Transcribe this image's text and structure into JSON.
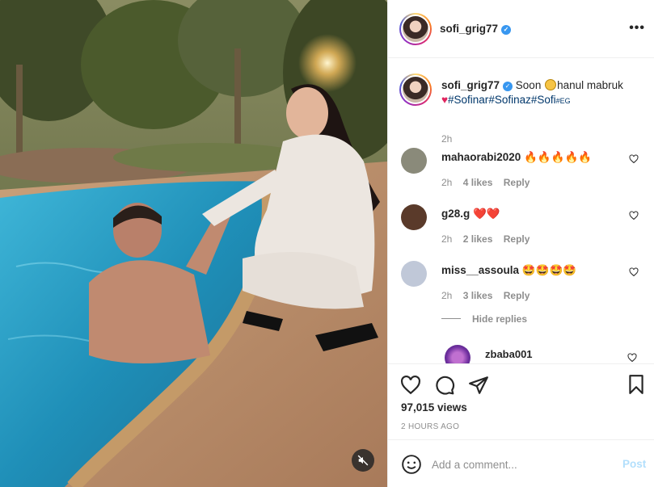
{
  "media": {
    "mute_icon": "speaker-muted-icon"
  },
  "header": {
    "username": "sofi_grig77",
    "verified_icon": "verified-badge-icon",
    "more_icon": "more-options-icon",
    "more_text": "•••"
  },
  "caption": {
    "username": "sofi_grig77",
    "text_start": "Soon",
    "text_after_emoji": "hanul mabruk",
    "hashtags": [
      "#Sofinar",
      "#Sofinaz",
      "#Sofi",
      "#EG"
    ],
    "time": "2h"
  },
  "comments": [
    {
      "username": "mahaorabi2020",
      "text": "🔥🔥🔥🔥🔥",
      "time": "2h",
      "likes": "4 likes",
      "reply": "Reply",
      "avatar_color": "#8a8a7a"
    },
    {
      "username": "g28.g",
      "text": "❤️❤️",
      "time": "2h",
      "likes": "2 likes",
      "reply": "Reply",
      "avatar_color": "#5a3a2a"
    },
    {
      "username": "miss__assoula",
      "text": "🤩🤩🤩🤩",
      "time": "2h",
      "likes": "3 likes",
      "reply": "Reply",
      "avatar_color": "#c0c8d8"
    }
  ],
  "hide_replies": "Hide replies",
  "reply": {
    "username": "zbaba001"
  },
  "actions": {
    "views": "97,015 views",
    "posted": "2 HOURS AGO"
  },
  "add_comment": {
    "placeholder": "Add a comment...",
    "post_label": "Post"
  },
  "colors": {
    "link": "#00376b",
    "meta": "#8e8e8e",
    "post_disabled": "#b2dffc",
    "verified": "#3897f0"
  }
}
